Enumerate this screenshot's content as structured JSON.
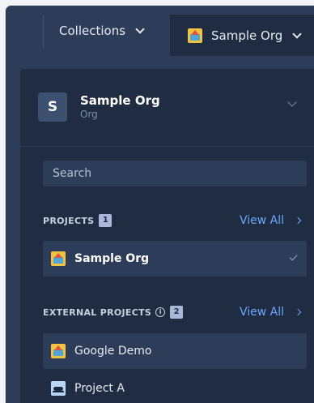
{
  "topbar": {
    "collections_label": "Collections",
    "org_label": "Sample Org"
  },
  "panel": {
    "org": {
      "avatar_letter": "S",
      "name": "Sample Org",
      "type": "Org"
    },
    "search": {
      "placeholder": "Search",
      "value": ""
    },
    "projects": {
      "title": "PROJECTS",
      "count": "1",
      "view_all": "View All",
      "items": [
        {
          "label": "Sample Org",
          "icon": "house-icon",
          "selected": true
        }
      ]
    },
    "external_projects": {
      "title": "EXTERNAL PROJECTS",
      "info_glyph": "i",
      "count": "2",
      "view_all": "View All",
      "items": [
        {
          "label": "Google Demo",
          "icon": "house-icon"
        },
        {
          "label": "Project A",
          "icon": "ant-icon"
        }
      ]
    }
  },
  "colors": {
    "topbar_bg": "#2d3d59",
    "panel_bg": "#1f2c42",
    "link": "#6aa9ff",
    "badge": "#a9b8d8"
  }
}
